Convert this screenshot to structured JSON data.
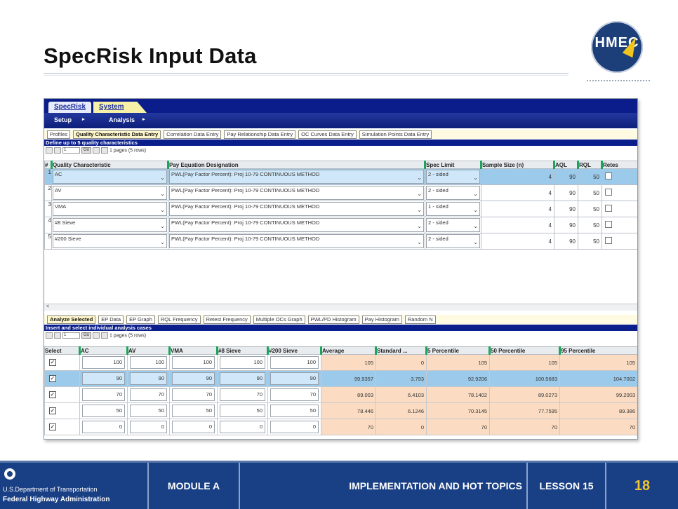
{
  "slide": {
    "title": "SpecRisk Input Data"
  },
  "logo": {
    "text": "HMEC",
    "colors": {
      "circle": "#1c3f7a",
      "bolt": "#f0c41b"
    }
  },
  "app": {
    "tabs": [
      {
        "label": "SpecRisk",
        "active": true
      },
      {
        "label": "System",
        "active": false
      }
    ],
    "menu": [
      "Setup",
      "Analysis"
    ],
    "input_tabs": [
      "Profiles",
      "Quality Characteristic Data Entry",
      "Correlation Data Entry",
      "Pay Relationship Data Entry",
      "OC Curves Data Entry",
      "Simulation Points Data Entry"
    ],
    "input_panel": {
      "header": "Define up to 5 quality characteristics",
      "pager": {
        "page_value": "1",
        "go": "Go",
        "summary": "1 pages (5 rows)"
      },
      "columns": [
        "#",
        "Quality Characteristic",
        "Pay Equation Designation",
        "Spec Limit",
        "Sample Size (n)",
        "AQL",
        "RQL",
        "Retes"
      ],
      "rows": [
        {
          "num": "1",
          "qc": "AC",
          "pay": "PWL(Pay Factor Percent): Proj 10-79 CONTINUOUS METHOD",
          "spec": "2 - sided",
          "n": "4",
          "aql": "90",
          "rql": "50"
        },
        {
          "num": "2",
          "qc": "AV",
          "pay": "PWL(Pay Factor Percent): Proj 10-79 CONTINUOUS METHOD",
          "spec": "2 - sided",
          "n": "4",
          "aql": "90",
          "rql": "50"
        },
        {
          "num": "3",
          "qc": "VMA",
          "pay": "PWL(Pay Factor Percent): Proj 10-79 CONTINUOUS METHOD",
          "spec": "1 - sided",
          "n": "4",
          "aql": "90",
          "rql": "50"
        },
        {
          "num": "4",
          "qc": "#8 Sieve",
          "pay": "PWL(Pay Factor Percent): Proj 10-79 CONTINUOUS METHOD",
          "spec": "2 - sided",
          "n": "4",
          "aql": "90",
          "rql": "50"
        },
        {
          "num": "5",
          "qc": "#200 Sieve",
          "pay": "PWL(Pay Factor Percent): Proj 10-79 CONTINUOUS METHOD",
          "spec": "2 - sided",
          "n": "4",
          "aql": "90",
          "rql": "50"
        }
      ]
    },
    "analysis_tabs": [
      "Analyze Selected",
      "EP Data",
      "EP Graph",
      "RQL Frequency",
      "Retest Frequency",
      "Multiple OCs Graph",
      "PWL/PD Histogram",
      "Pay Histogram",
      "Random N"
    ],
    "analysis_panel": {
      "header": "Insert and select individual analysis cases",
      "pager": {
        "page_value": "1",
        "go": "Go",
        "summary": "1 pages (5 rows)"
      },
      "columns": [
        "Select",
        "AC",
        "AV",
        "VMA",
        "#8 Sieve",
        "#200 Sieve",
        "Average",
        "Standard ...",
        "5 Percentile",
        "50 Percentile",
        "95 Percentile"
      ],
      "rows": [
        {
          "inputs": [
            "100",
            "100",
            "100",
            "100",
            "100"
          ],
          "results": [
            "105",
            "0",
            "105",
            "105",
            "105"
          ]
        },
        {
          "inputs": [
            "90",
            "90",
            "90",
            "90",
            "90"
          ],
          "results": [
            "99.9357",
            "3.793",
            "92.9206",
            "100.5683",
            "104.7002"
          ]
        },
        {
          "inputs": [
            "70",
            "70",
            "70",
            "70",
            "70"
          ],
          "results": [
            "89.003",
            "6.4103",
            "78.1402",
            "89.0273",
            "99.2003"
          ]
        },
        {
          "inputs": [
            "50",
            "50",
            "50",
            "50",
            "50"
          ],
          "results": [
            "78.446",
            "6.1246",
            "70.3145",
            "77.7595",
            "89.386"
          ]
        },
        {
          "inputs": [
            "0",
            "0",
            "0",
            "0",
            "0"
          ],
          "results": [
            "70",
            "0",
            "70",
            "70",
            "70"
          ]
        }
      ]
    }
  },
  "footer": {
    "dept": "U.S.Department of Transportation",
    "agency": "Federal Highway Administration",
    "module": "MODULE A",
    "topic": "IMPLEMENTATION AND HOT TOPICS",
    "lesson": "LESSON 15",
    "page": "18",
    "colors": {
      "bar": "#193f84",
      "page_number": "#f1c232"
    }
  }
}
